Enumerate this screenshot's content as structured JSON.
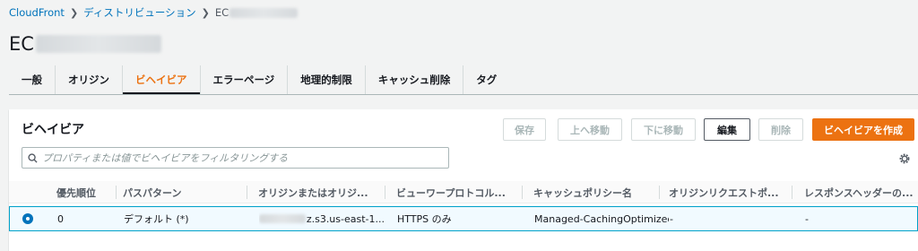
{
  "breadcrumb": {
    "items": [
      "CloudFront",
      "ディストリビューション"
    ],
    "current_prefix": "EC"
  },
  "page": {
    "title_prefix": "EC"
  },
  "tabs": [
    {
      "label": "一般"
    },
    {
      "label": "オリジン"
    },
    {
      "label": "ビヘイビア",
      "active": true
    },
    {
      "label": "エラーページ"
    },
    {
      "label": "地理的制限"
    },
    {
      "label": "キャッシュ削除"
    },
    {
      "label": "タグ"
    }
  ],
  "panel": {
    "title": "ビヘイビア",
    "buttons": {
      "save": "保存",
      "move_up": "上へ移動",
      "move_down": "下に移動",
      "edit": "編集",
      "delete": "削除",
      "create": "ビヘイビアを作成"
    },
    "search": {
      "placeholder": "プロパティまたは値でビヘイビアをフィルタリングする"
    }
  },
  "table": {
    "columns": [
      "優先順位",
      "パスパターン",
      "オリジンまたはオリジ...",
      "ビューワープロトコル...",
      "キャッシュポリシー名",
      "オリジンリクエストポ...",
      "レスポンスヘッダーの..."
    ],
    "rows": [
      {
        "selected": true,
        "priority": "0",
        "path": "デフォルト (*)",
        "origin_suffix": "z.s3.us-east-1...",
        "protocol": "HTTPS のみ",
        "cache_policy": "Managed-CachingOptimized",
        "origin_request": "-",
        "response_headers": "-"
      }
    ]
  },
  "colors": {
    "accent": "#ec7211",
    "link": "#0073bb",
    "selected_row_border": "#00a1c9",
    "selected_row_bg": "#f1faff"
  }
}
